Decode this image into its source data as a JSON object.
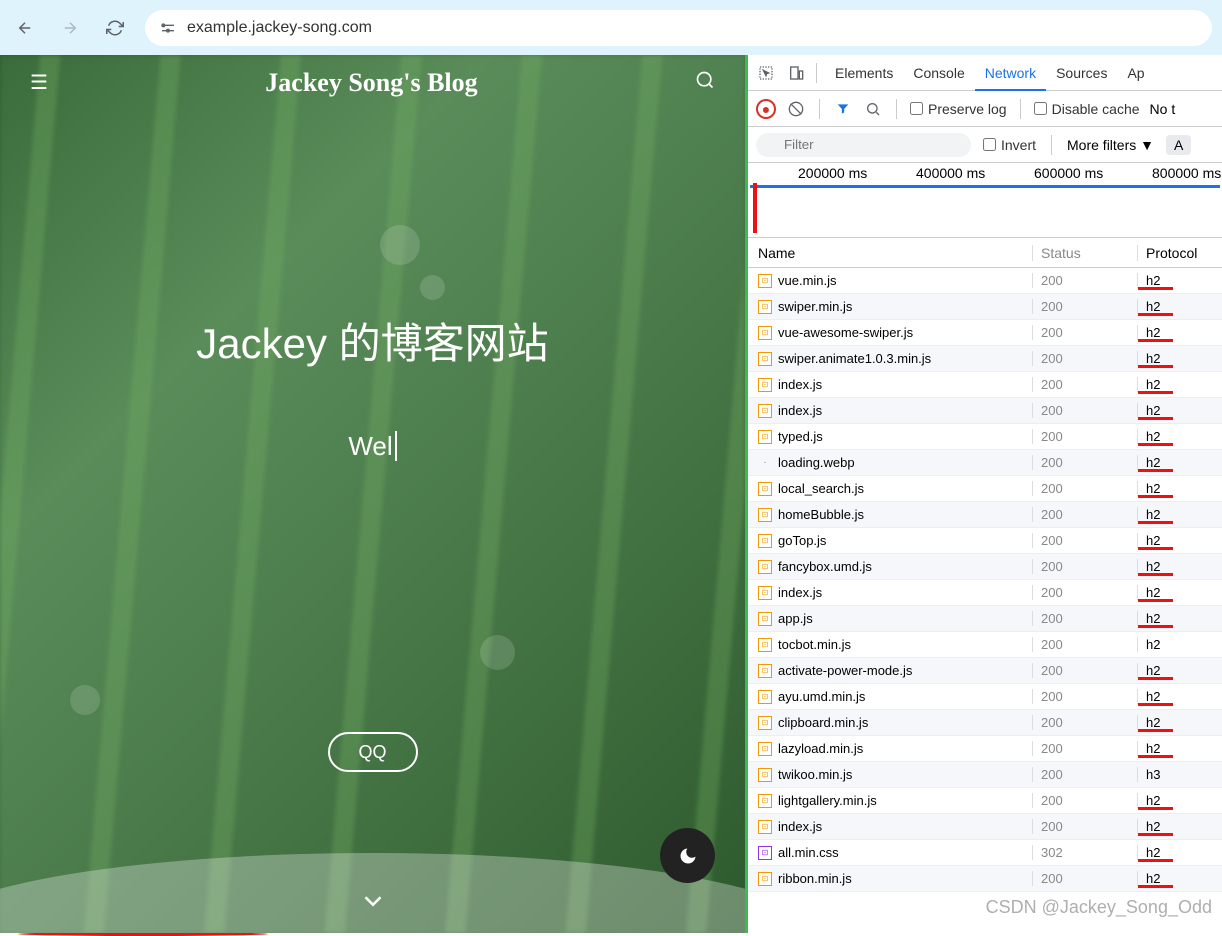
{
  "browser": {
    "url": "example.jackey-song.com"
  },
  "blog": {
    "title": "Jackey Song's Blog",
    "hero_title": "Jackey 的博客网站",
    "hero_subtitle": "Wel",
    "qq_label": "QQ"
  },
  "devtools": {
    "tabs": [
      "Elements",
      "Console",
      "Network",
      "Sources",
      "Ap"
    ],
    "active_tab": 2,
    "preserve_log": "Preserve log",
    "disable_cache": "Disable cache",
    "no_t": "No t",
    "filter_placeholder": "Filter",
    "invert": "Invert",
    "more_filters": "More filters",
    "timeline": [
      "200000 ms",
      "400000 ms",
      "600000 ms",
      "800000 ms"
    ],
    "columns": {
      "name": "Name",
      "status": "Status",
      "protocol": "Protocol"
    },
    "rows": [
      {
        "name": "vue.min.js",
        "status": "200",
        "protocol": "h2",
        "type": "js",
        "u": true
      },
      {
        "name": "swiper.min.js",
        "status": "200",
        "protocol": "h2",
        "type": "js",
        "u": true
      },
      {
        "name": "vue-awesome-swiper.js",
        "status": "200",
        "protocol": "h2",
        "type": "js",
        "u": true
      },
      {
        "name": "swiper.animate1.0.3.min.js",
        "status": "200",
        "protocol": "h2",
        "type": "js",
        "u": true
      },
      {
        "name": "index.js",
        "status": "200",
        "protocol": "h2",
        "type": "js",
        "u": true
      },
      {
        "name": "index.js",
        "status": "200",
        "protocol": "h2",
        "type": "js",
        "u": true
      },
      {
        "name": "typed.js",
        "status": "200",
        "protocol": "h2",
        "type": "js",
        "u": true
      },
      {
        "name": "loading.webp",
        "status": "200",
        "protocol": "h2",
        "type": "img",
        "u": true
      },
      {
        "name": "local_search.js",
        "status": "200",
        "protocol": "h2",
        "type": "js",
        "u": true
      },
      {
        "name": "homeBubble.js",
        "status": "200",
        "protocol": "h2",
        "type": "js",
        "u": true
      },
      {
        "name": "goTop.js",
        "status": "200",
        "protocol": "h2",
        "type": "js",
        "u": true
      },
      {
        "name": "fancybox.umd.js",
        "status": "200",
        "protocol": "h2",
        "type": "js",
        "u": true
      },
      {
        "name": "index.js",
        "status": "200",
        "protocol": "h2",
        "type": "js",
        "u": true
      },
      {
        "name": "app.js",
        "status": "200",
        "protocol": "h2",
        "type": "js",
        "u": true
      },
      {
        "name": "tocbot.min.js",
        "status": "200",
        "protocol": "h2",
        "type": "js",
        "u": false
      },
      {
        "name": "activate-power-mode.js",
        "status": "200",
        "protocol": "h2",
        "type": "js",
        "u": true
      },
      {
        "name": "ayu.umd.min.js",
        "status": "200",
        "protocol": "h2",
        "type": "js",
        "u": true
      },
      {
        "name": "clipboard.min.js",
        "status": "200",
        "protocol": "h2",
        "type": "js",
        "u": true
      },
      {
        "name": "lazyload.min.js",
        "status": "200",
        "protocol": "h2",
        "type": "js",
        "u": true
      },
      {
        "name": "twikoo.min.js",
        "status": "200",
        "protocol": "h3",
        "type": "js",
        "u": false
      },
      {
        "name": "lightgallery.min.js",
        "status": "200",
        "protocol": "h2",
        "type": "js",
        "u": true
      },
      {
        "name": "index.js",
        "status": "200",
        "protocol": "h2",
        "type": "js",
        "u": true
      },
      {
        "name": "all.min.css",
        "status": "302",
        "protocol": "h2",
        "type": "css",
        "u": true
      },
      {
        "name": "ribbon.min.js",
        "status": "200",
        "protocol": "h2",
        "type": "js",
        "u": true
      }
    ]
  },
  "watermark": "CSDN @Jackey_Song_Odd"
}
